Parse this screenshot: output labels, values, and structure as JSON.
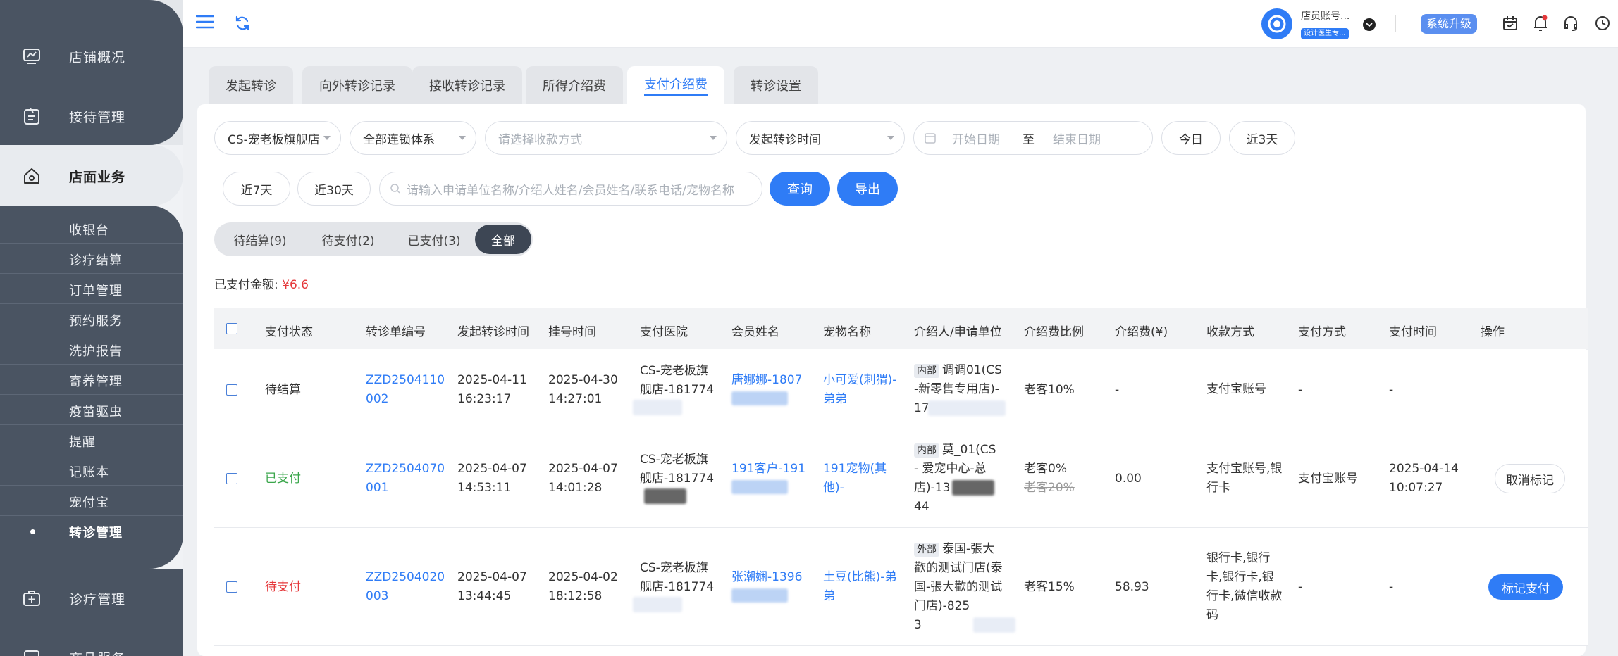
{
  "sidebar": {
    "top_items": [
      {
        "label": "店铺概况",
        "icon": "monitor-icon"
      },
      {
        "label": "接待管理",
        "icon": "clipboard-icon"
      }
    ],
    "active_item": {
      "label": "店面业务",
      "icon": "shop-icon"
    },
    "sub_items": [
      "收银台",
      "诊疗结算",
      "订单管理",
      "预约服务",
      "洗护报告",
      "寄养管理",
      "疫苗驱虫",
      "提醒",
      "记账本",
      "宠付宝",
      "转诊管理"
    ],
    "bottom_items": [
      {
        "label": "诊疗管理",
        "icon": "medkit-icon"
      },
      {
        "label": "商品服务",
        "icon": "box-icon"
      }
    ]
  },
  "header": {
    "account_name": "店员账号...",
    "account_badge": "设计医生专...",
    "upgrade_label": "系统升级"
  },
  "tabs": [
    "发起转诊",
    "向外转诊记录",
    "接收转诊记录",
    "所得介绍费",
    "支付介绍费",
    "转诊设置"
  ],
  "filters": {
    "store": "CS-宠老板旗舰店",
    "chain": "全部连锁体系",
    "pay_method_placeholder": "请选择收款方式",
    "time_type": "发起转诊时间",
    "start_placeholder": "开始日期",
    "to": "至",
    "end_placeholder": "结束日期",
    "today": "今日",
    "last3": "近3天",
    "last7": "近7天",
    "last30": "近30天",
    "search_placeholder": "请输入申请单位名称/介绍人姓名/会员姓名/联系电话/宠物名称",
    "query": "查询",
    "export": "导出"
  },
  "status_tabs": [
    "待结算(9)",
    "待支付(2)",
    "已支付(3)",
    "全部"
  ],
  "summary": {
    "label": "已支付金额:",
    "amount": "¥6.6"
  },
  "table": {
    "headers": [
      "支付状态",
      "转诊单编号",
      "发起转诊时间",
      "挂号时间",
      "支付医院",
      "会员姓名",
      "宠物名称",
      "介绍人/申请单位",
      "介绍费比例",
      "介绍费(¥)",
      "收款方式",
      "支付方式",
      "支付时间",
      "操作"
    ],
    "rows": [
      {
        "status": "待结算",
        "status_color": "#333333",
        "no1": "ZZD2504110",
        "no2": "002",
        "t1": "2025-04-11",
        "t1b": "16:23:17",
        "t2": "2025-04-30",
        "t2b": "14:27:01",
        "hosp1": "CS-宠老板旗",
        "hosp2": "舰店-181774",
        "member": "唐娜娜-1807",
        "pet1": "小可爱(刺猬)-",
        "pet2": "弟弟",
        "ref_tag": "内部",
        "ref1": "调调01(CS",
        "ref2": "-新零售专用店)-",
        "ref3": "17",
        "ratio": "老客10%",
        "ratio_old": "",
        "fee": "-",
        "receive": [
          "支付宝账号"
        ],
        "paymethod": "-",
        "paytime1": "-",
        "paytime2": "",
        "op": ""
      },
      {
        "status": "已支付",
        "status_color": "#3aa64b",
        "no1": "ZZD2504070",
        "no2": "001",
        "t1": "2025-04-07",
        "t1b": "14:53:11",
        "t2": "2025-04-07",
        "t2b": "14:01:28",
        "hosp1": "CS-宠老板旗",
        "hosp2": "舰店-181774",
        "member": "191客户-191",
        "pet1": "191宠物(其",
        "pet2": "他)-",
        "ref_tag": "内部",
        "ref1": "莫_01(CS",
        "ref2": "- 爱宠中心-总",
        "ref3": "店)-13",
        "ref4": "44",
        "ratio": "老客0%",
        "ratio_old": "老客20%",
        "fee": "0.00",
        "receive": [
          "支付宝账号,银",
          "行卡"
        ],
        "paymethod": "支付宝账号",
        "paytime1": "2025-04-14",
        "paytime2": "10:07:27",
        "op": "取消标记"
      },
      {
        "status": "待支付",
        "status_color": "#e5383b",
        "no1": "ZZD2504020",
        "no2": "003",
        "t1": "2025-04-07",
        "t1b": "13:44:45",
        "t2": "2025-04-02",
        "t2b": "18:12:58",
        "hosp1": "CS-宠老板旗",
        "hosp2": "舰店-181774",
        "member": "张潮娴-1396",
        "pet1": "土豆(比熊)-弟",
        "pet2": "弟",
        "ref_tag": "外部",
        "ref1": "泰国-張大",
        "ref2": "歡的测试门店(泰",
        "ref3": "国-張大歡的测试",
        "ref4": "门店)-825",
        "ref5": "3",
        "ratio": "老客15%",
        "ratio_old": "",
        "fee": "58.93",
        "receive": [
          "银行卡,银行",
          "卡,银行卡,银",
          "行卡,微信收款",
          "码"
        ],
        "paymethod": "-",
        "paytime1": "-",
        "paytime2": "",
        "op": "标记支付"
      }
    ]
  }
}
